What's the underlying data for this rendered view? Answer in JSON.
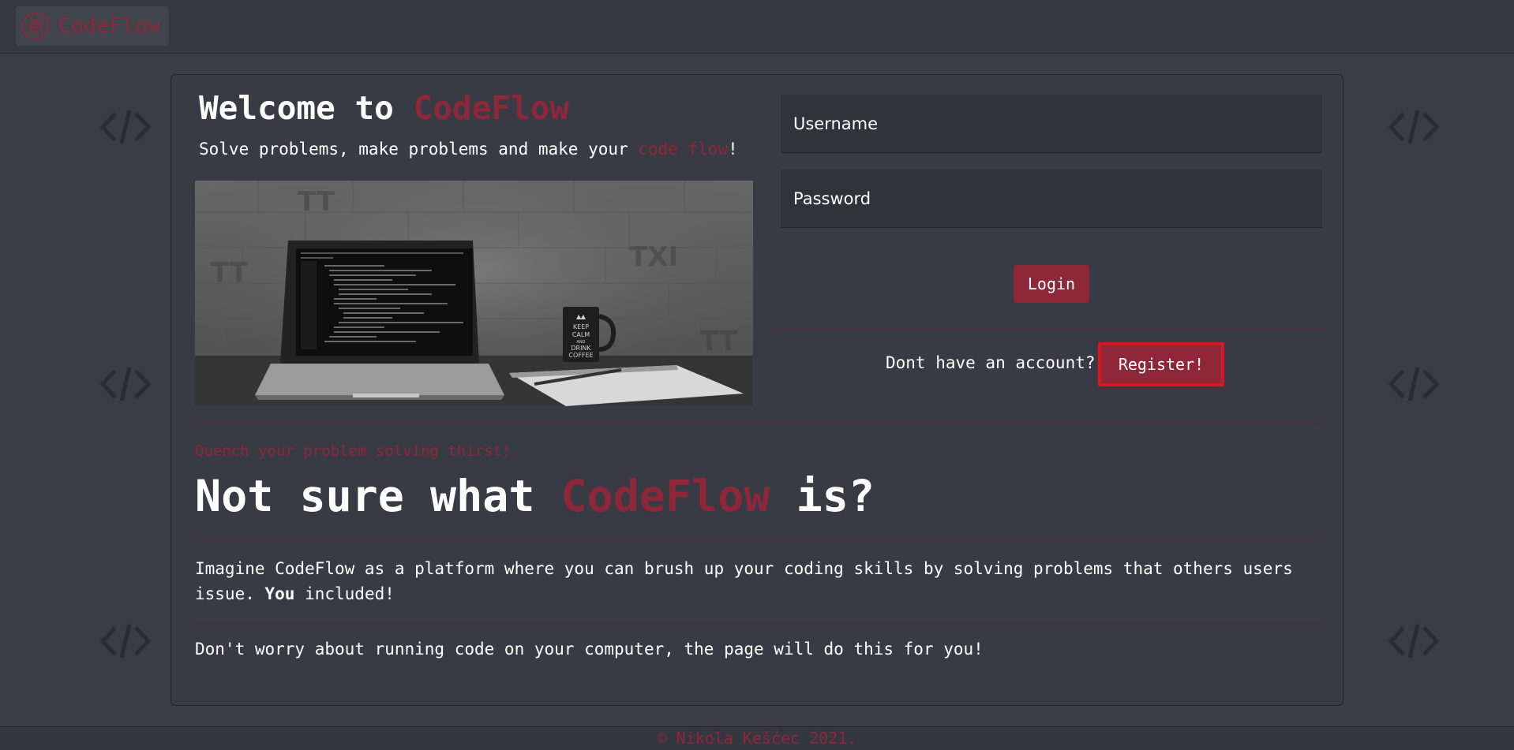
{
  "navbar": {
    "brand": "CodeFlow",
    "logo_icon": "lion-logo-icon"
  },
  "welcome": {
    "prefix": "Welcome to ",
    "brand": "CodeFlow",
    "sub_prefix": "Solve problems, make problems and make your ",
    "sub_accent": "code flow",
    "sub_suffix": "!"
  },
  "login": {
    "username_placeholder": "Username",
    "password_placeholder": "Password",
    "login_label": "Login",
    "account_prompt": "Dont have an account?",
    "register_label": "Register!"
  },
  "about": {
    "tagline": "Quench your problem solving thirst!",
    "heading_prefix": "Not sure what ",
    "heading_brand": "CodeFlow",
    "heading_suffix": " is?",
    "para1_prefix": "Imagine CodeFlow as a platform where you can brush up your coding skills by solving problems that others users issue. ",
    "para1_bold": "You",
    "para1_suffix": " included!",
    "para2": "Don't worry about running code on your computer, the page will do this for you!"
  },
  "footer": {
    "text": "© Nikola Kešćec 2021."
  },
  "colors": {
    "accent": "#8e2739",
    "background": "#3a3d47",
    "card": "#383b43",
    "register_outline": "#e0131f"
  }
}
